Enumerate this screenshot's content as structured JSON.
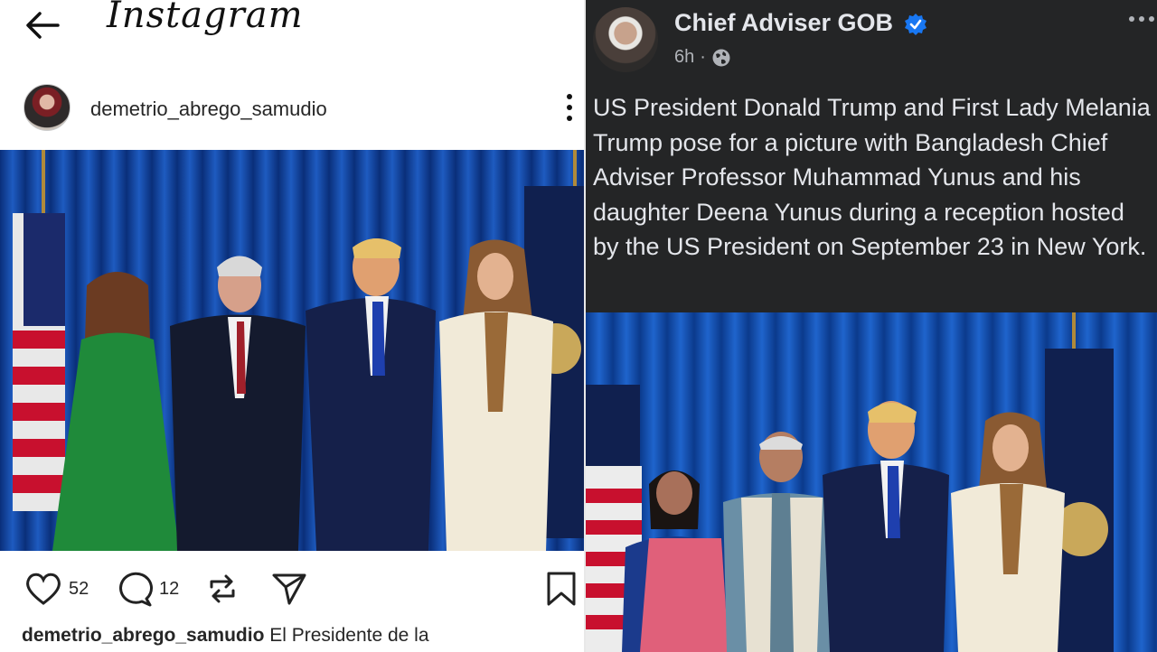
{
  "instagram": {
    "app_name": "Instagram",
    "username": "demetrio_abrego_samudio",
    "likes": "52",
    "comments": "12",
    "caption_user": "demetrio_abrego_samudio",
    "caption_text": "El Presidente de la"
  },
  "facebook": {
    "page_name": "Chief Adviser GOB",
    "time": "6h",
    "separator": "·",
    "post_text": "US President Donald Trump and First Lady Melania Trump pose for a picture with Bangladesh Chief Adviser Professor Muhammad Yunus and his daughter Deena Yunus during a reception hosted by the US President on September 23 in New York.",
    "verified_color": "#1877f2"
  },
  "icons": [
    "back-arrow-icon",
    "heart-icon",
    "comment-icon",
    "repost-icon",
    "share-icon",
    "bookmark-icon",
    "more-vertical-icon",
    "verified-icon",
    "globe-icon",
    "more-horizontal-icon"
  ]
}
